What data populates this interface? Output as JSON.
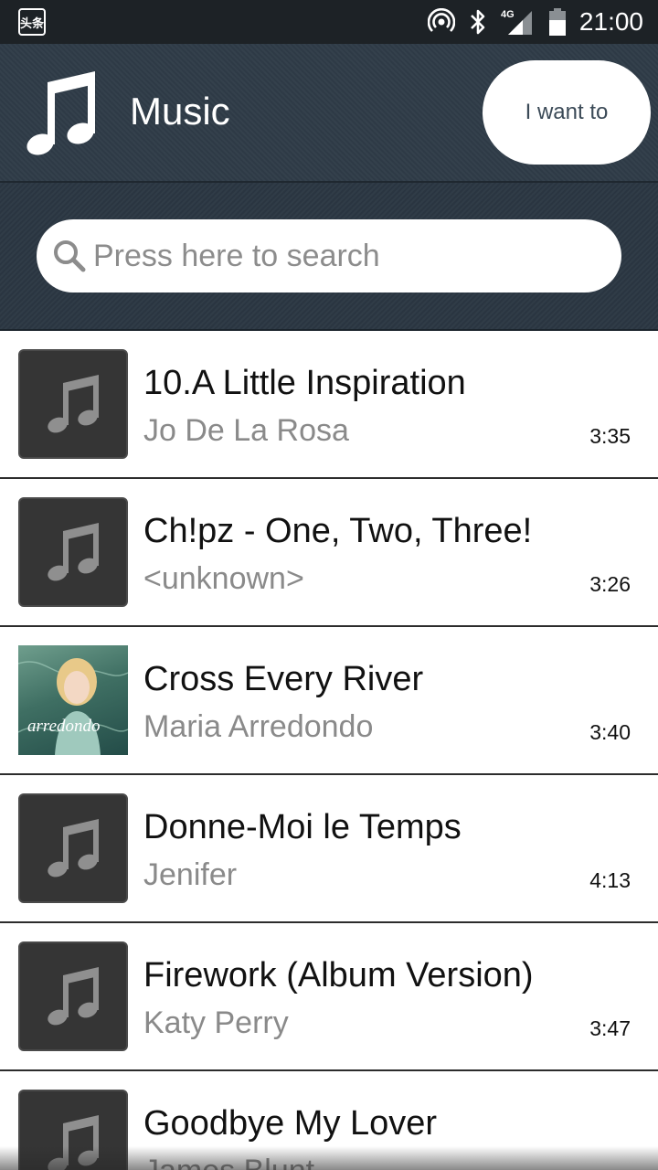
{
  "status_bar": {
    "app_badge": "头条",
    "network": "4G",
    "time": "21:00",
    "icons": [
      "hotspot-icon",
      "bluetooth-icon",
      "signal-icon",
      "battery-icon"
    ]
  },
  "header": {
    "title": "Music",
    "logo_icon": "music-note-icon",
    "action_button": "I want to"
  },
  "search": {
    "placeholder": "Press here to search",
    "icon": "search-icon"
  },
  "songs": [
    {
      "title": "10.A Little Inspiration",
      "artist": "Jo De La Rosa",
      "duration": "3:35",
      "art": "placeholder"
    },
    {
      "title": "Ch!pz - One, Two, Three!",
      "artist": "<unknown>",
      "duration": "3:26",
      "art": "placeholder"
    },
    {
      "title": "Cross Every River",
      "artist": "Maria Arredondo",
      "duration": "3:40",
      "art": "album-cover",
      "art_text": "arredondo"
    },
    {
      "title": "Donne-Moi le Temps",
      "artist": "Jenifer",
      "duration": "4:13",
      "art": "placeholder"
    },
    {
      "title": "Firework (Album Version)",
      "artist": "Katy Perry",
      "duration": "3:47",
      "art": "placeholder"
    },
    {
      "title": "Goodbye My Lover",
      "artist": "James Blunt",
      "duration": "",
      "art": "placeholder"
    }
  ],
  "colors": {
    "status_bar": "#1d2226",
    "header": "#2f3c48",
    "search_area": "#2b3743",
    "placeholder_art": "#353535",
    "title_text": "#111111",
    "artist_text": "#8a8a8a"
  }
}
